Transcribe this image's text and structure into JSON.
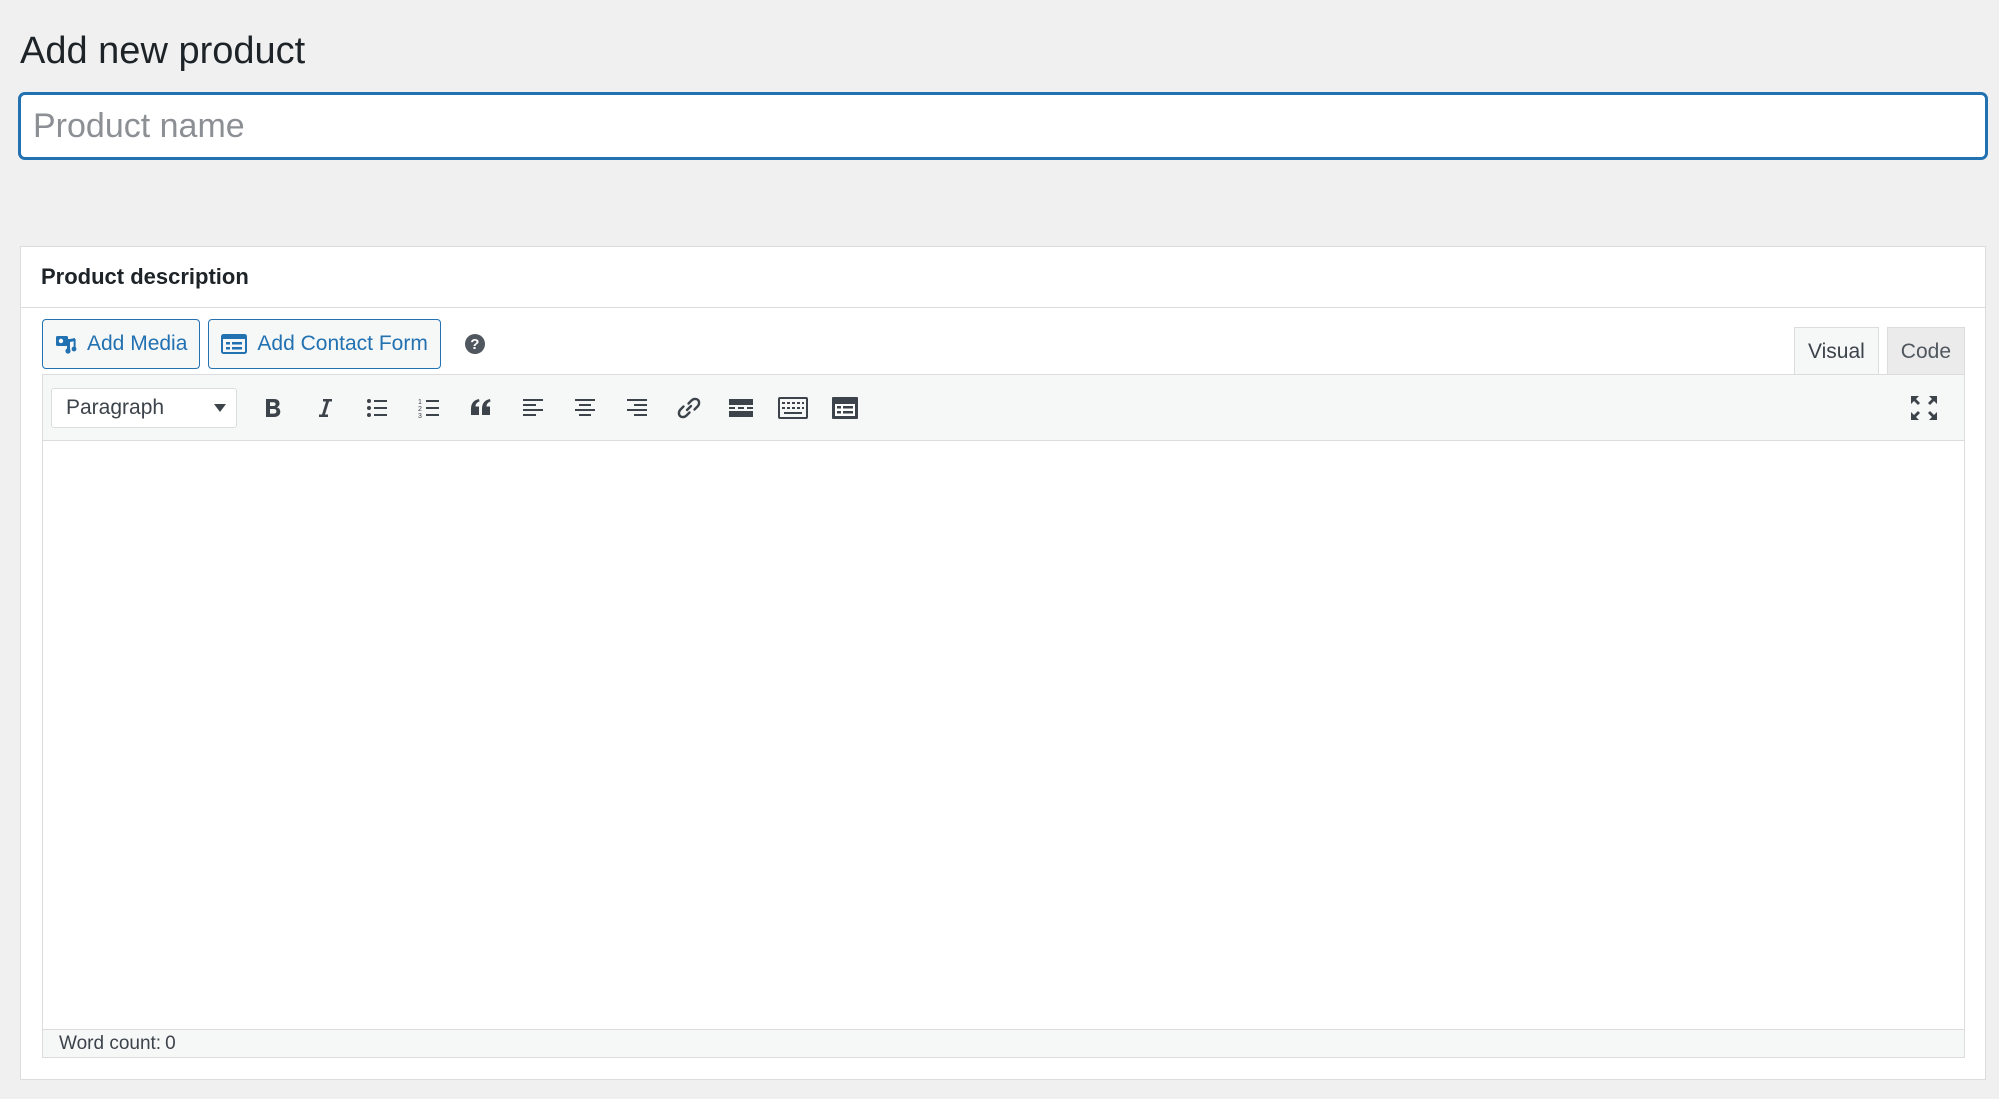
{
  "page": {
    "title": "Add new product"
  },
  "product_name": {
    "placeholder": "Product name",
    "value": ""
  },
  "description_box": {
    "title": "Product description",
    "media_buttons": {
      "add_media_label": "Add Media",
      "add_contact_form_label": "Add Contact Form",
      "help_glyph": "?"
    },
    "tabs": [
      {
        "label": "Visual",
        "active": true
      },
      {
        "label": "Code",
        "active": false
      }
    ],
    "toolbar": {
      "format_select_value": "Paragraph",
      "buttons": [
        {
          "name": "bold-icon"
        },
        {
          "name": "italic-icon"
        },
        {
          "name": "bulleted-list-icon"
        },
        {
          "name": "numbered-list-icon"
        },
        {
          "name": "blockquote-icon"
        },
        {
          "name": "align-left-icon"
        },
        {
          "name": "align-center-icon"
        },
        {
          "name": "align-right-icon"
        },
        {
          "name": "link-icon"
        },
        {
          "name": "read-more-icon"
        },
        {
          "name": "toolbar-toggle-icon"
        },
        {
          "name": "form-icon"
        }
      ],
      "fullscreen_icon": "fullscreen-icon"
    },
    "status": {
      "word_count_label": "Word count:",
      "word_count_value": "0"
    }
  },
  "colors": {
    "accent": "#2271b1",
    "background": "#f0f0f1",
    "text": "#1d2327",
    "icon": "#3c434a"
  }
}
